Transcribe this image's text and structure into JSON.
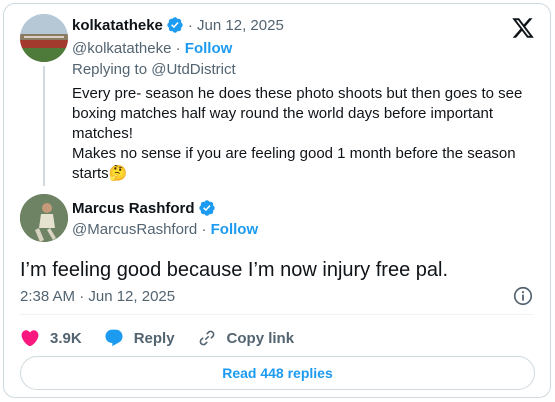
{
  "brand": {
    "logo_icon": "x-logo-icon",
    "accent": "#1d9bf0",
    "verified_color": "#1d9bf0",
    "like_color": "#f91880"
  },
  "reply_tweet": {
    "display_name": "kolkatatheke",
    "date": "· Jun 12, 2025",
    "handle": "@kolkatatheke",
    "separator": "·",
    "follow_label": "Follow",
    "replying_prefix": "Replying to ",
    "replying_to": "@UtdDistrict",
    "body_lines": [
      "Every pre- season he does these photo shoots but then goes to see boxing matches half way round the world days before important matches!",
      "Makes no sense if you are feeling good 1 month before the season starts🤔"
    ]
  },
  "main_tweet": {
    "display_name": "Marcus Rashford",
    "handle": "@MarcusRashford",
    "separator": "·",
    "follow_label": "Follow",
    "text": "I’m feeling good because I’m now injury free pal.",
    "timestamp": "2:38 AM · Jun 12, 2025"
  },
  "actions": {
    "likes": "3.9K",
    "reply_label": "Reply",
    "copy_link_label": "Copy link"
  },
  "read_replies_label": "Read 448 replies"
}
